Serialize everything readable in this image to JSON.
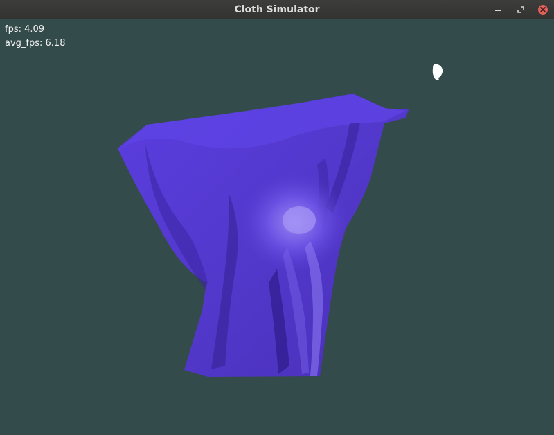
{
  "window": {
    "title": "Cloth Simulator",
    "buttons": {
      "minimize_icon": "minimize-icon",
      "maximize_icon": "maximize-icon",
      "close_icon": "close-icon"
    }
  },
  "hud": {
    "fps": "fps: 4.09",
    "avg_fps": "avg_fps: 6.18"
  },
  "scene": {
    "background_color": "#344b4b",
    "cloth_color": "#5a3fd6",
    "cloth_highlight_color": "#8f7cf2",
    "cloth_shadow_color": "#2c1a7a",
    "cursor_color": "#ffffff"
  }
}
